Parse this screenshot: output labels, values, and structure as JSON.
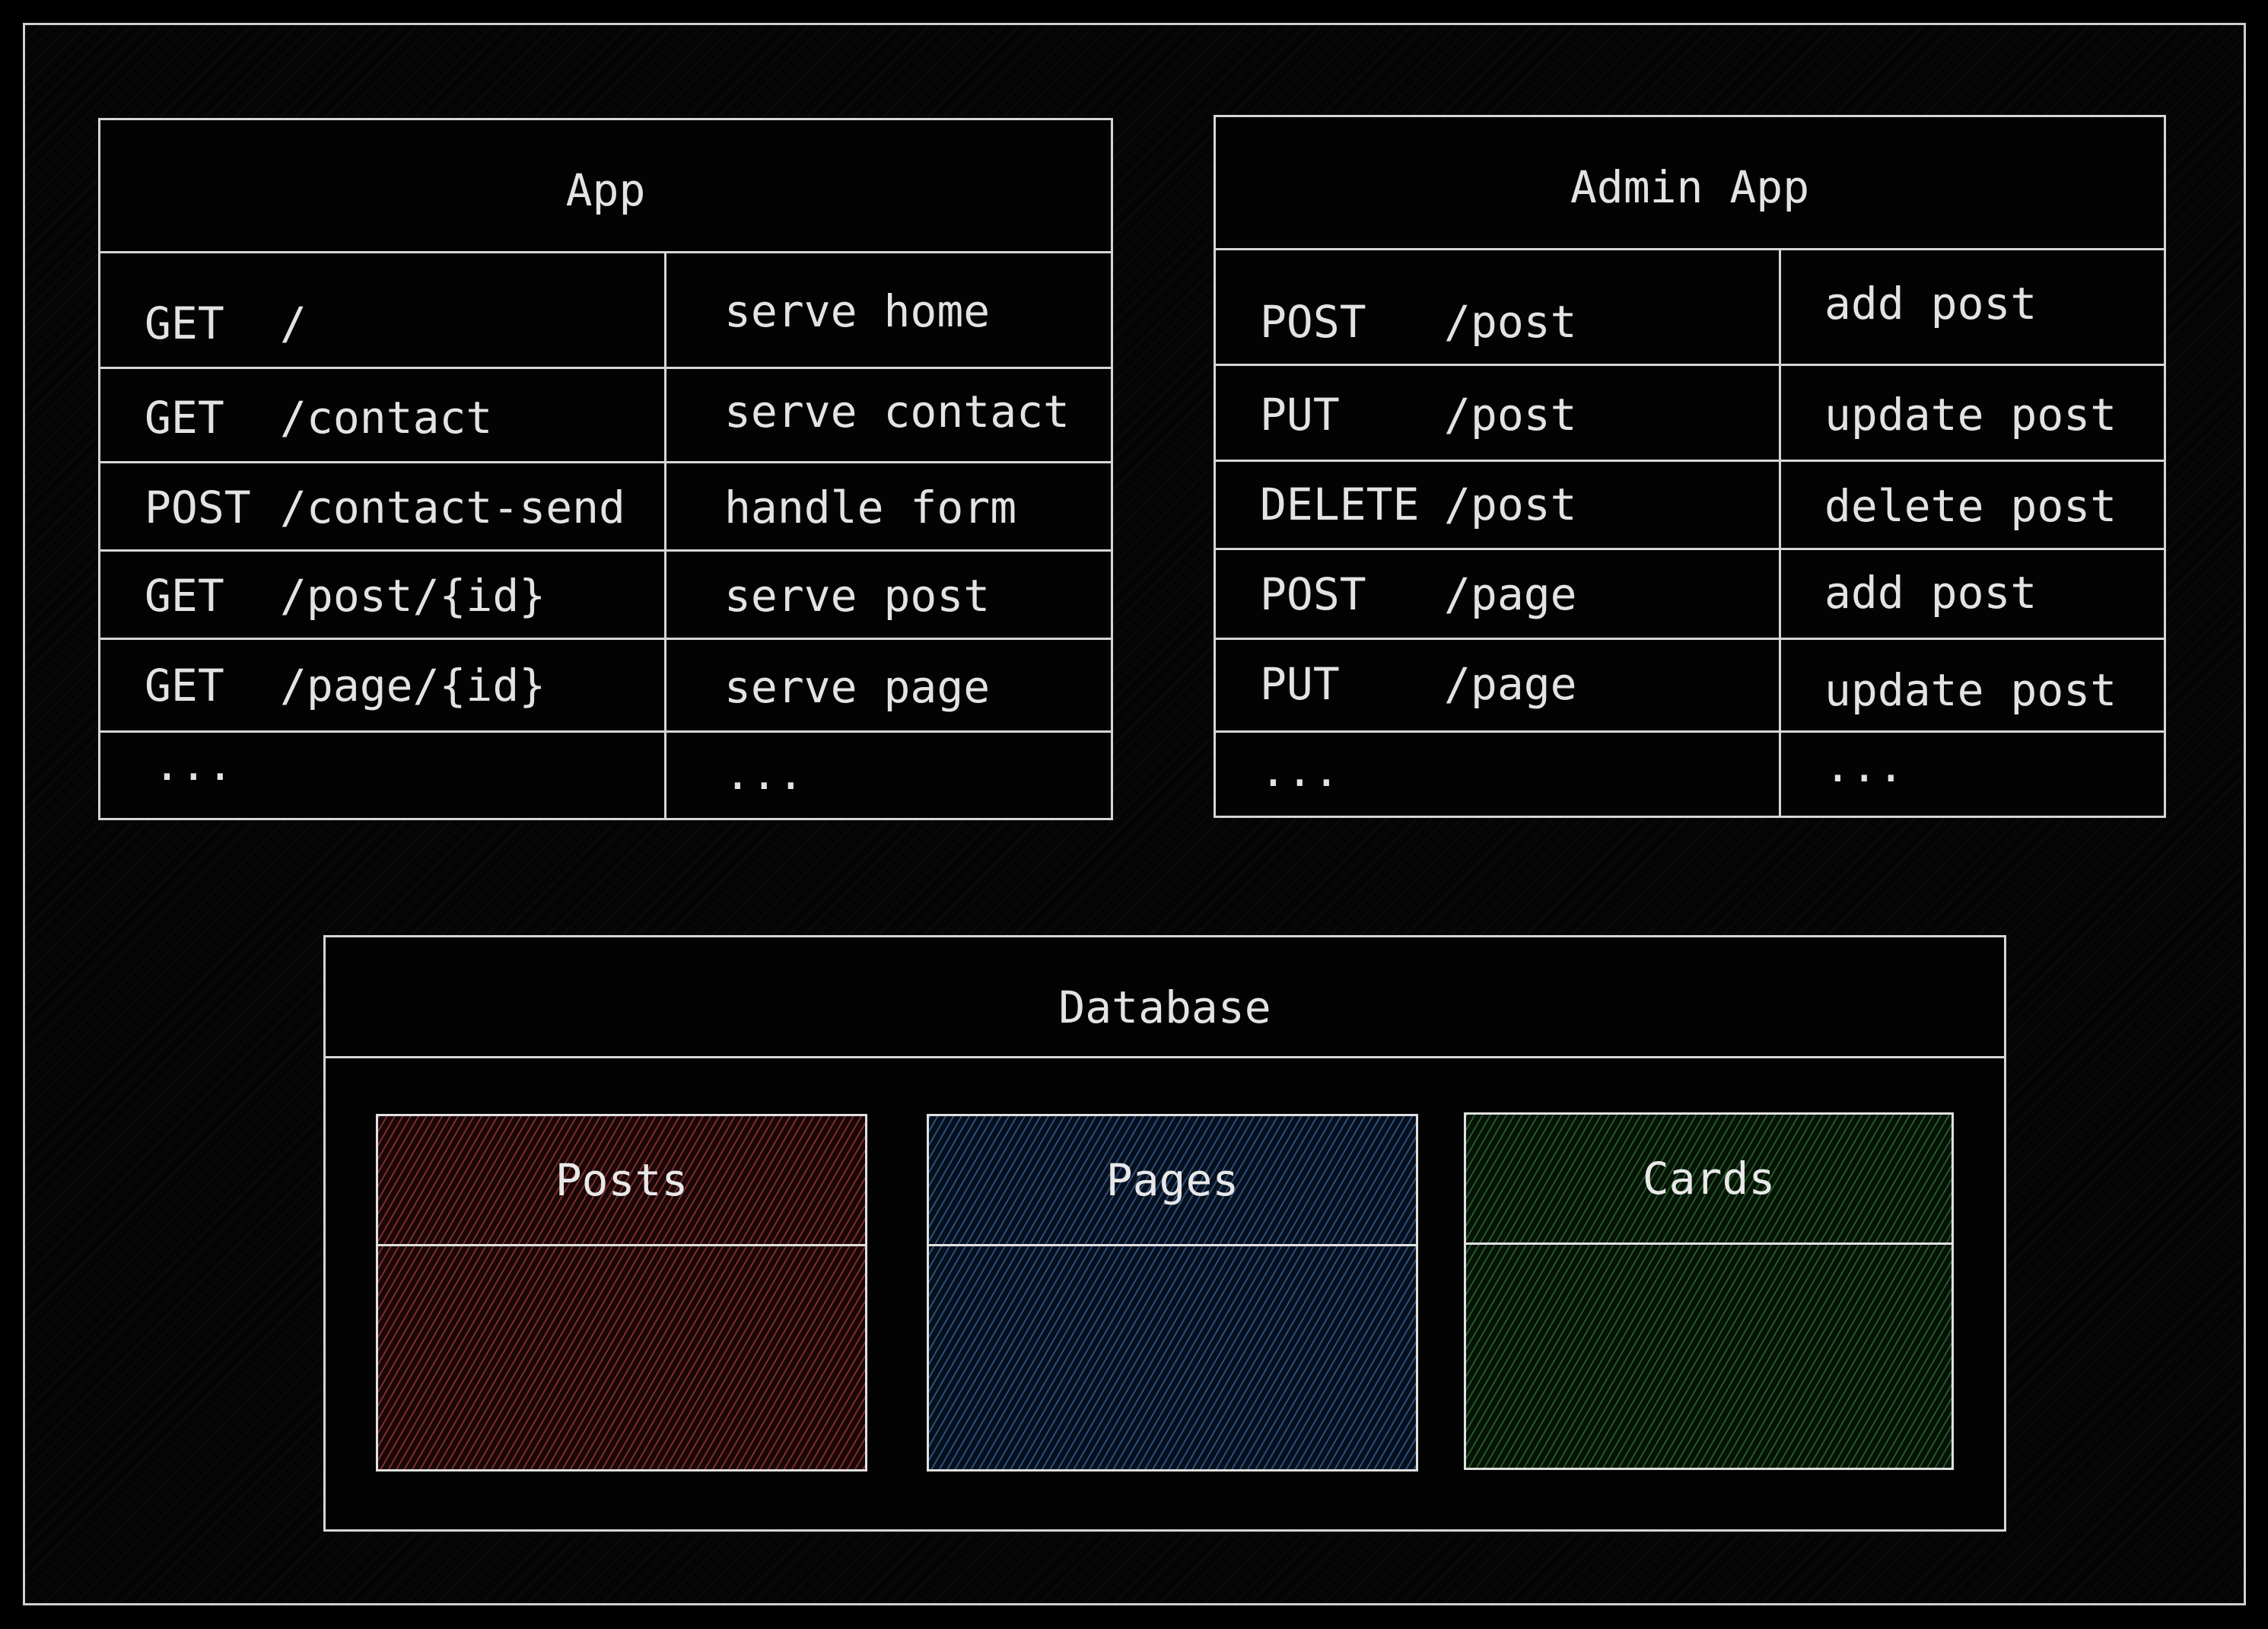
{
  "app": {
    "title": "App",
    "rows": [
      {
        "method": "GET",
        "path": "/",
        "action": "serve home"
      },
      {
        "method": "GET",
        "path": "/contact",
        "action": "serve contact"
      },
      {
        "method": "POST",
        "path": "/contact-send",
        "action": "handle form"
      },
      {
        "method": "GET",
        "path": "/post/{id}",
        "action": "serve post"
      },
      {
        "method": "GET",
        "path": "/page/{id}",
        "action": "serve page"
      },
      {
        "method": "...",
        "path": "",
        "action": "..."
      }
    ]
  },
  "admin_app": {
    "title": "Admin App",
    "rows": [
      {
        "method": "POST",
        "path": "/post",
        "action": "add post"
      },
      {
        "method": "PUT",
        "path": "/post",
        "action": "update post"
      },
      {
        "method": "DELETE",
        "path": "/post",
        "action": "delete post"
      },
      {
        "method": "POST",
        "path": "/page",
        "action": "add post"
      },
      {
        "method": "PUT",
        "path": "/page",
        "action": "update post"
      },
      {
        "method": "...",
        "path": "",
        "action": "..."
      }
    ]
  },
  "database": {
    "title": "Database",
    "tables": [
      {
        "name": "Posts",
        "color": "#c85050"
      },
      {
        "name": "Pages",
        "color": "#4678be"
      },
      {
        "name": "Cards",
        "color": "#3c9646"
      }
    ]
  }
}
